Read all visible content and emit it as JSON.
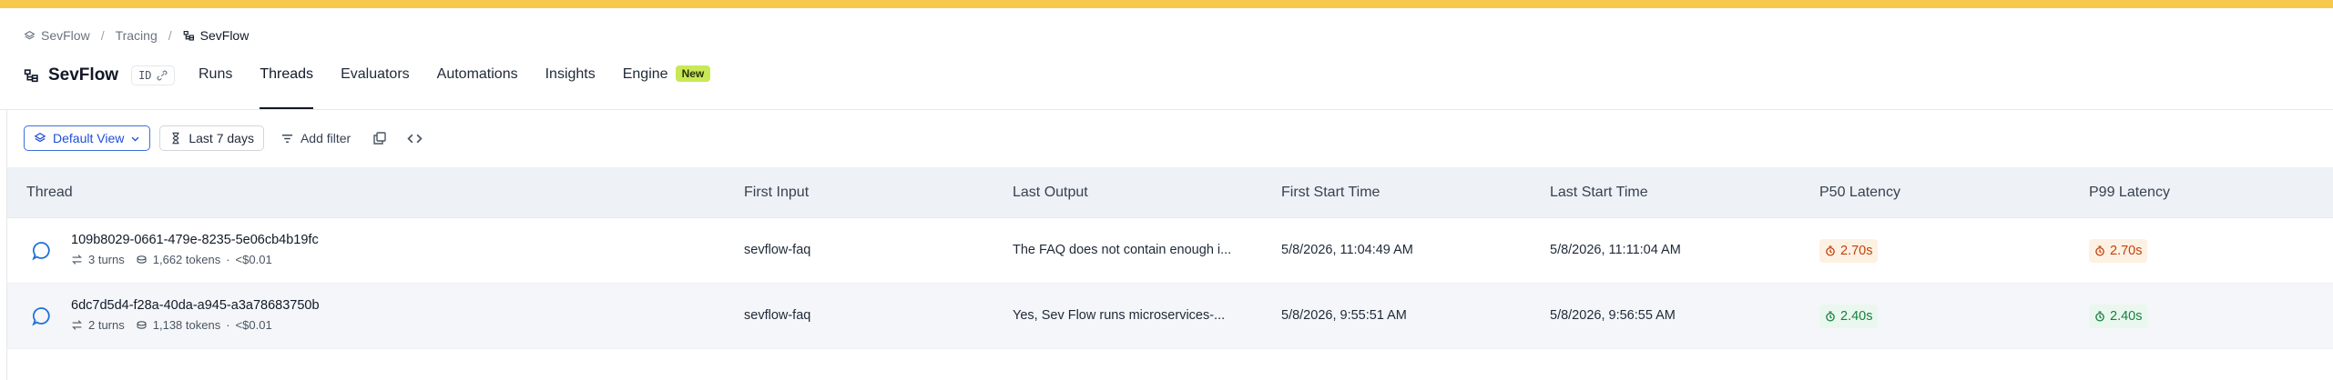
{
  "breadcrumb": {
    "items": [
      {
        "label": "SevFlow",
        "icon": "workspace-icon"
      },
      {
        "label": "Tracing"
      },
      {
        "label": "SevFlow",
        "icon": "project-icon"
      }
    ],
    "separator": "/"
  },
  "project": {
    "name": "SevFlow",
    "id_label": "ID"
  },
  "tabs": [
    {
      "label": "Runs",
      "active": false
    },
    {
      "label": "Threads",
      "active": true
    },
    {
      "label": "Evaluators",
      "active": false
    },
    {
      "label": "Automations",
      "active": false
    },
    {
      "label": "Insights",
      "active": false
    },
    {
      "label": "Engine",
      "active": false,
      "badge": "New"
    }
  ],
  "toolbar": {
    "view_label": "Default View",
    "time_label": "Last 7 days",
    "filter_label": "Add filter"
  },
  "table": {
    "columns": [
      "Thread",
      "First Input",
      "Last Output",
      "First Start Time",
      "Last Start Time",
      "P50 Latency",
      "P99 Latency"
    ],
    "rows": [
      {
        "thread_id": "109b8029-0661-479e-8235-5e06cb4b19fc",
        "turns": "3 turns",
        "tokens": "1,662 tokens",
        "cost": "<$0.01",
        "first_input": "sevflow-faq",
        "last_output": "The FAQ does not contain enough i...",
        "first_start": "5/8/2026, 11:04:49 AM",
        "last_start": "5/8/2026, 11:11:04 AM",
        "p50": "2.70s",
        "p99": "2.70s",
        "latency_status": "warn"
      },
      {
        "thread_id": "6dc7d5d4-f28a-40da-a945-a3a78683750b",
        "turns": "2 turns",
        "tokens": "1,138 tokens",
        "cost": "<$0.01",
        "first_input": "sevflow-faq",
        "last_output": "Yes, Sev Flow runs microservices-...",
        "first_start": "5/8/2026, 9:55:51 AM",
        "last_start": "5/8/2026, 9:56:55 AM",
        "p50": "2.40s",
        "p99": "2.40s",
        "latency_status": "ok"
      }
    ]
  },
  "colors": {
    "accent_bar": "#f6c94a",
    "link_blue": "#1d4ed8",
    "warn": "#c2410c",
    "ok": "#15803d",
    "new_badge": "#c9e857"
  }
}
